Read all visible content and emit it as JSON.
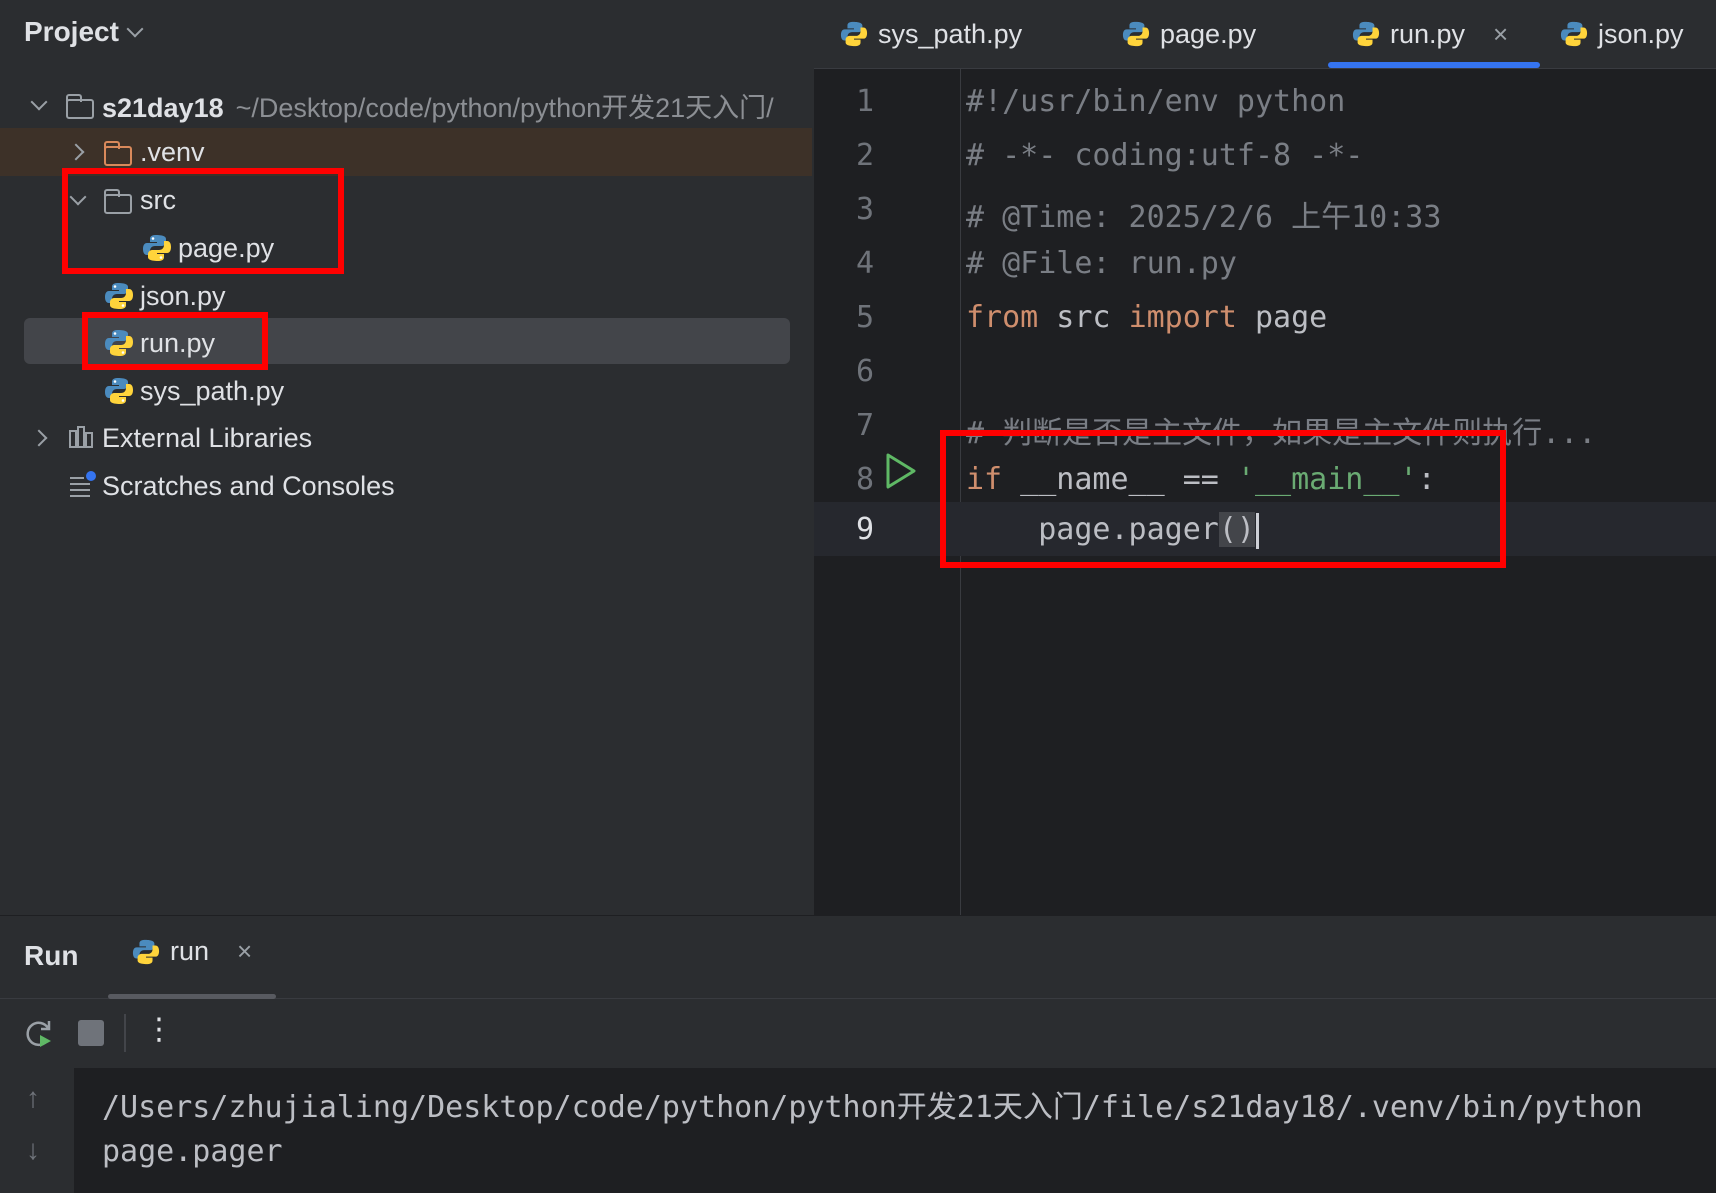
{
  "project": {
    "title": "Project",
    "root_name": "s21day18",
    "root_path": "~/Desktop/code/python/python开发21天入门/",
    "items": [
      {
        "label": ".venv"
      },
      {
        "label": "src"
      },
      {
        "label": "page.py"
      },
      {
        "label": "json.py"
      },
      {
        "label": "run.py"
      },
      {
        "label": "sys_path.py"
      },
      {
        "label": "External Libraries"
      },
      {
        "label": "Scratches and Consoles"
      }
    ]
  },
  "editor": {
    "tabs": [
      {
        "label": "sys_path.py"
      },
      {
        "label": "page.py"
      },
      {
        "label": "run.py",
        "active": true
      },
      {
        "label": "json.py"
      }
    ],
    "tab_close": "×",
    "line_numbers": [
      "1",
      "2",
      "3",
      "4",
      "5",
      "6",
      "7",
      "8",
      "9"
    ],
    "code": {
      "l1": "#!/usr/bin/env python",
      "l2": "# -*- coding:utf-8 -*-",
      "l3": "# @Time: 2025/2/6 上午10:33",
      "l4": "# @File: run.py",
      "l5_kw1": "from",
      "l5_mod": " src ",
      "l5_kw2": "import",
      "l5_name": " page",
      "l7": "# 判断是否是主文件，如果是主文件则执行...",
      "l8_kw": "if",
      "l8_mid": " __name__ == ",
      "l8_str": "'__main__'",
      "l8_end": ":",
      "l9_call": "    page.pager",
      "l9_paren": "()"
    }
  },
  "run": {
    "title": "Run",
    "tab_label": "run",
    "tab_close": "×",
    "more_label": "⋮",
    "console_lines": [
      "/Users/zhujialing/Desktop/code/python/python开发21天入门/file/s21day18/.venv/bin/python",
      "page.pager"
    ],
    "scroll_up": "↑",
    "scroll_down": "↓"
  },
  "colors": {
    "accent": "#3574f0",
    "highlight_box": "#ff0000",
    "run_green": "#5fb865",
    "python_blue": "#4b8bbe",
    "python_yellow": "#ffd43b"
  }
}
